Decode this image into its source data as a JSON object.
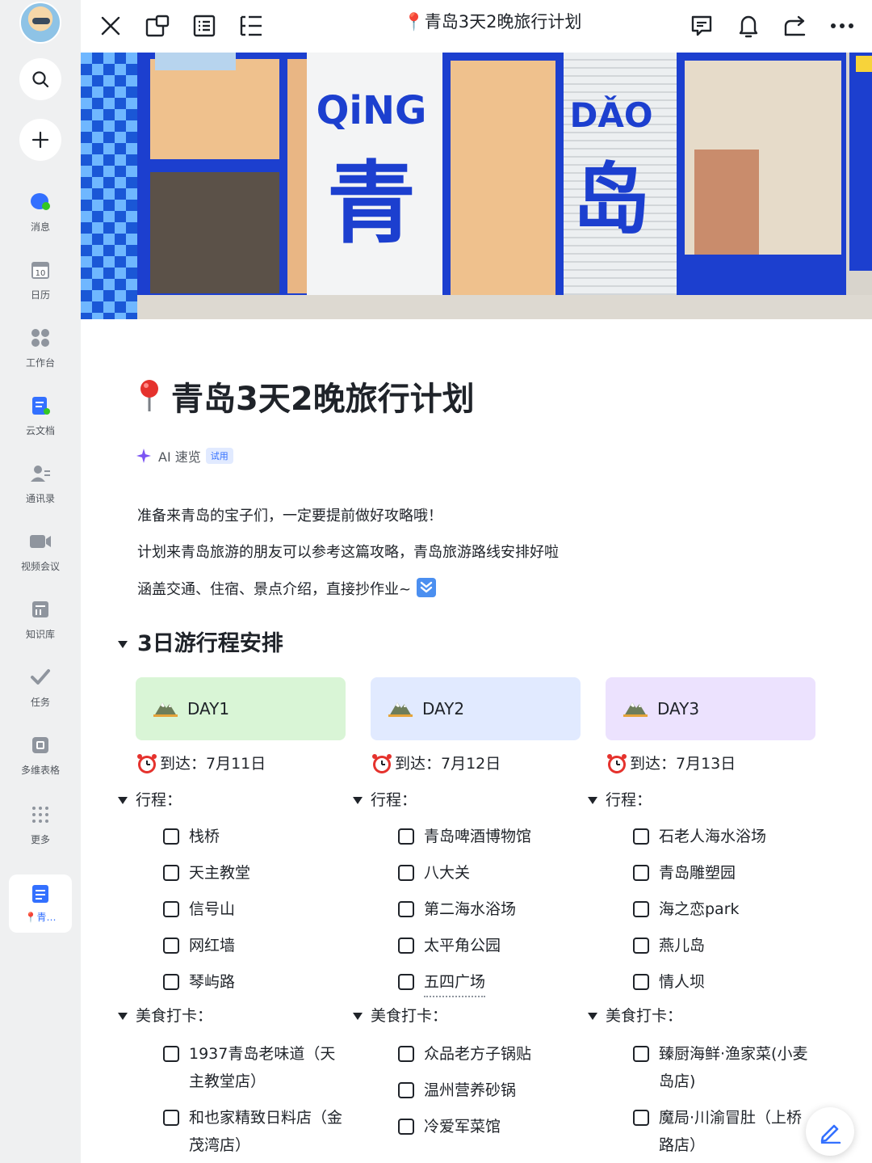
{
  "sidebar": {
    "items": [
      {
        "label": "消息",
        "icon": "chat-bubble-icon"
      },
      {
        "label": "日历",
        "icon": "calendar-icon",
        "day": "10"
      },
      {
        "label": "工作台",
        "icon": "workspace-icon"
      },
      {
        "label": "云文档",
        "icon": "cloud-doc-icon"
      },
      {
        "label": "通讯录",
        "icon": "contacts-icon"
      },
      {
        "label": "视频会议",
        "icon": "video-icon"
      },
      {
        "label": "知识库",
        "icon": "knowledge-icon"
      },
      {
        "label": "任务",
        "icon": "task-icon"
      },
      {
        "label": "多维表格",
        "icon": "base-icon"
      },
      {
        "label": "更多",
        "icon": "more-grid-icon"
      }
    ],
    "active": {
      "label": "📍青…",
      "icon": "doc-icon"
    }
  },
  "toolbar": {
    "title": "📍青岛3天2晚旅行计划"
  },
  "banner": {
    "left_sign": "QiNG",
    "left_char": "青",
    "right_sign": "DǍO",
    "right_char": "岛"
  },
  "doc": {
    "title": "青岛3天2晚旅行计划",
    "ai_label": "AI 速览",
    "ai_badge": "试用",
    "intro": [
      "准备来青岛的宝子们，一定要提前做好攻略哦！",
      "计划来青岛旅游的朋友可以参考这篇攻略，青岛旅游路线安排好啦",
      "涵盖交通、住宿、景点介绍，直接抄作业~"
    ],
    "section_title": "3日游行程安排",
    "days": [
      {
        "label": "DAY1",
        "color": "#d9f5d6",
        "arrive": "到达：7月11日",
        "itinerary_label": "行程：",
        "itinerary": [
          "栈桥",
          "天主教堂",
          "信号山",
          "网红墙",
          "琴屿路"
        ],
        "food_label": "美食打卡：",
        "food": [
          "1937青岛老味道（天主教堂店）",
          "和也家精致日料店（金茂湾店）"
        ]
      },
      {
        "label": "DAY2",
        "color": "#e1eaff",
        "arrive": "到达：7月12日",
        "itinerary_label": "行程：",
        "itinerary": [
          "青岛啤酒博物馆",
          "八大关",
          "第二海水浴场",
          "太平角公园",
          "五四广场"
        ],
        "food_label": "美食打卡：",
        "food": [
          "众品老方子锅贴",
          "温州营养砂锅",
          "冷爱军菜馆"
        ]
      },
      {
        "label": "DAY3",
        "color": "#ece2fe",
        "arrive": "到达：7月13日",
        "itinerary_label": "行程：",
        "itinerary": [
          "石老人海水浴场",
          "青岛雕塑园",
          "海之恋park",
          "燕儿岛",
          "情人坝"
        ],
        "food_label": "美食打卡：",
        "food": [
          "臻厨海鲜·渔家菜(小麦岛店)",
          "魔局·川渝冒肚（上桥路店）"
        ]
      }
    ]
  }
}
